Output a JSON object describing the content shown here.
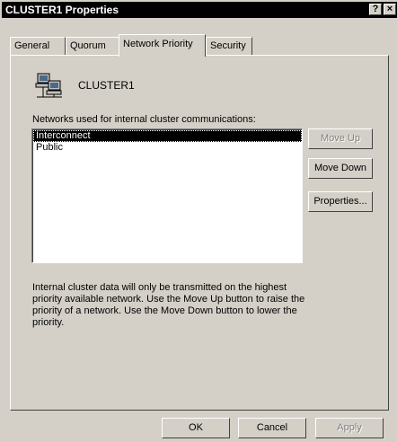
{
  "window": {
    "title": "CLUSTER1 Properties",
    "help_button": "?",
    "close_button": "×"
  },
  "tabs": [
    {
      "label": "General",
      "active": false
    },
    {
      "label": "Quorum",
      "active": false
    },
    {
      "label": "Network Priority",
      "active": true
    },
    {
      "label": "Security",
      "active": false
    }
  ],
  "cluster": {
    "icon": "cluster-icon",
    "name": "CLUSTER1"
  },
  "networks": {
    "label": "Networks used for internal cluster communications:",
    "items": [
      {
        "label": "Interconnect",
        "selected": true
      },
      {
        "label": "Public",
        "selected": false
      }
    ]
  },
  "side_buttons": {
    "move_up": "Move Up",
    "move_down": "Move Down",
    "properties": "Properties..."
  },
  "description": "Internal cluster data will only be transmitted on the highest priority available network. Use the Move Up button to raise the priority of a network. Use the Move Down button to lower the priority.",
  "footer": {
    "ok": "OK",
    "cancel": "Cancel",
    "apply": "Apply"
  }
}
